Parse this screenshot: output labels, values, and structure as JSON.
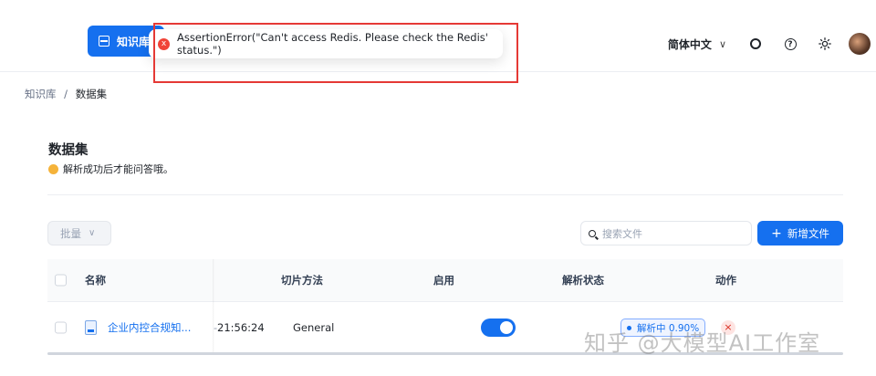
{
  "header": {
    "nav_label": "知识库",
    "language": "简体中文",
    "language_chevron": "∨"
  },
  "toast": {
    "type": "error",
    "icon": "x",
    "message": "AssertionError(\"Can't access Redis. Please check the Redis' status.\")"
  },
  "breadcrumb": {
    "parent": "知识库",
    "separator": "/",
    "current": "数据集"
  },
  "page": {
    "title": "数据集",
    "subtitle": "解析成功后才能问答哦。"
  },
  "toolbar": {
    "batch_label": "批量",
    "batch_chevron": "∨",
    "search_placeholder": "搜索文件",
    "add_label": "新增文件",
    "add_icon": "+"
  },
  "table": {
    "columns": [
      "名称",
      "切片方法",
      "启用",
      "解析状态",
      "动作"
    ],
    "rows": [
      {
        "name": "企业内控合规知...",
        "time": "21:56:24",
        "chunk_method": "General",
        "enabled": true,
        "status": "解析中 0.90%",
        "action_icon": "×"
      }
    ]
  },
  "watermark": "知乎 @大模型AI工作室",
  "colors": {
    "primary": "#1570ef",
    "error": "#f04438",
    "highlight_box": "#e53935"
  }
}
